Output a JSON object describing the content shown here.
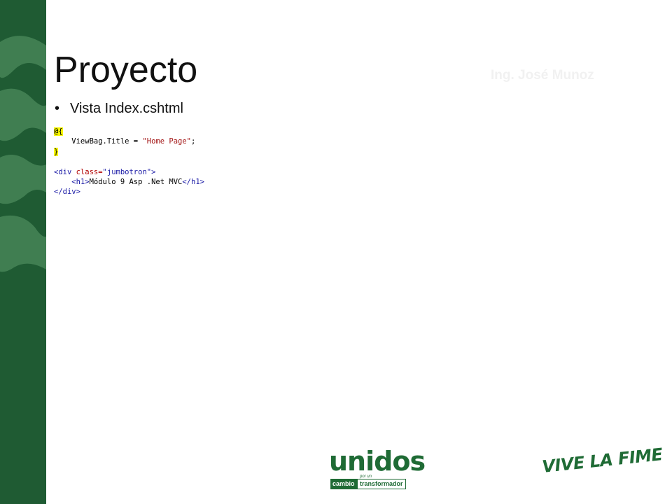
{
  "slide": {
    "title": "Proyecto",
    "author": "Ing. José Munoz",
    "bullet": "Vista Index.cshtml",
    "bullet_marker": "•"
  },
  "code": {
    "line1": "@{",
    "line2_prefix": "    ViewBag.Title = ",
    "line2_string": "\"Home Page\"",
    "line2_suffix": ";",
    "line3": "}",
    "line5_open": "<div ",
    "line5_attr": "class=",
    "line5_value": "\"jumbotron\"",
    "line5_close": ">",
    "line6_indent": "    ",
    "line6_open": "<h1>",
    "line6_text": "Módulo 9 Asp .Net MVC",
    "line6_close": "</h1>",
    "line7": "</div>"
  },
  "logos": {
    "unidos": "unidos",
    "unidos_small": "por un",
    "cambio": "cambio",
    "transformador": "transformador",
    "vive": "VIVE LA FIME"
  },
  "colors": {
    "sidebar": "#1f5b33",
    "brand_green": "#1f6b35",
    "highlight": "#f7f700"
  }
}
